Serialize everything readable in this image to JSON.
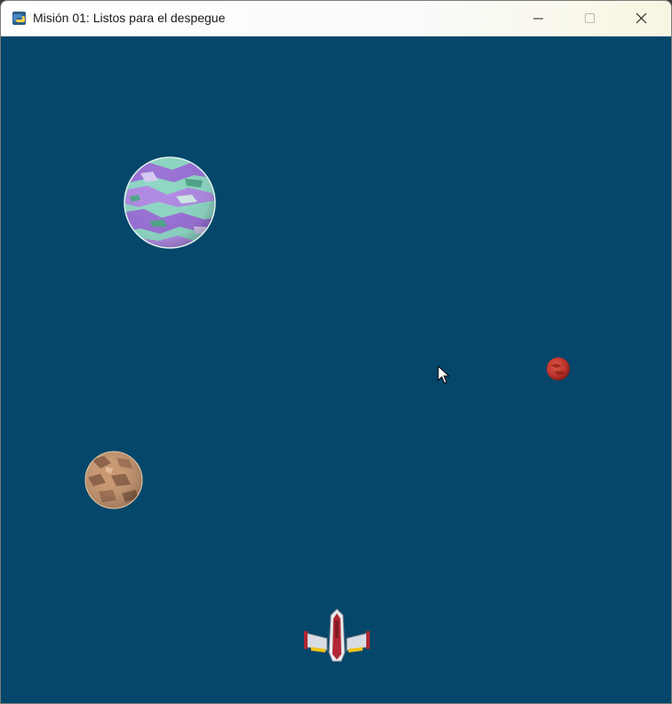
{
  "window": {
    "title": "Misión 01: Listos para el despegue",
    "icon": "python-icon",
    "controls": [
      "minimize-icon",
      "maximize-icon",
      "close-icon"
    ]
  },
  "game": {
    "background_color": "#04476a",
    "sprites": [
      {
        "name": "purple-green-planet",
        "colors": [
          "#8fd6c4",
          "#9a72d6"
        ]
      },
      {
        "name": "red-planet",
        "colors": [
          "#c23b2e",
          "#8e2318"
        ]
      },
      {
        "name": "brown-planet",
        "colors": [
          "#c9966e",
          "#8b5e42"
        ]
      },
      {
        "name": "player-spaceship",
        "colors": [
          "#d8dde3",
          "#b32633",
          "#f0c419"
        ]
      },
      {
        "name": "mouse-cursor"
      }
    ]
  }
}
